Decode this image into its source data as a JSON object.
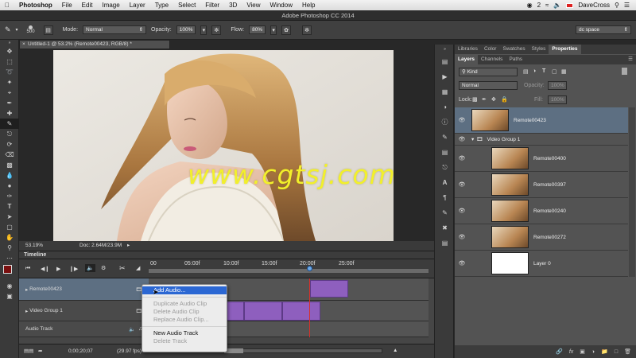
{
  "menubar": {
    "app": "Photoshop",
    "items": [
      "File",
      "Edit",
      "Image",
      "Layer",
      "Type",
      "Select",
      "Filter",
      "3D",
      "View",
      "Window",
      "Help"
    ],
    "badge": "2",
    "user": "DaveCross"
  },
  "title": "Adobe Photoshop CC 2014",
  "options": {
    "brush_size": "500",
    "mode_label": "Mode:",
    "mode_value": "Normal",
    "opacity_label": "Opacity:",
    "opacity_value": "100%",
    "flow_label": "Flow:",
    "flow_value": "80%",
    "workspace": "dc space"
  },
  "document": {
    "tab": "Untitled-1 @ 53.2% (Remote00423, RGB/8) *",
    "zoom": "53.19%",
    "doc_size": "Doc: 2.64M/23.9M",
    "watermark": "www.cgtsj.com"
  },
  "timeline": {
    "title": "Timeline",
    "ticks": [
      "00",
      "05:00f",
      "10:00f",
      "15:00f",
      "20:00f",
      "25:00f"
    ],
    "tracks": [
      {
        "name": "Remote00423"
      },
      {
        "name": "Video Group 1"
      },
      {
        "name": "Audio Track"
      }
    ],
    "timecode": "0;00;20;07",
    "fps": "(29.97 fps)"
  },
  "context_menu": {
    "items": [
      {
        "label": "Add Audio...",
        "state": "highlighted"
      },
      {
        "label": "Duplicate Audio Clip",
        "state": "disabled"
      },
      {
        "label": "Delete Audio Clip",
        "state": "disabled"
      },
      {
        "label": "Replace Audio Clip...",
        "state": "disabled"
      },
      {
        "label": "New Audio Track",
        "state": "enabled"
      },
      {
        "label": "Delete Track",
        "state": "disabled"
      }
    ]
  },
  "panels": {
    "top_tabs": [
      "Libraries",
      "Color",
      "Swatches",
      "Styles",
      "Properties"
    ],
    "layer_tabs": [
      "Layers",
      "Channels",
      "Paths"
    ],
    "kind_filter": "Kind",
    "blend_mode": "Normal",
    "opacity_label": "Opacity:",
    "opacity_value": "100%",
    "lock_label": "Lock:",
    "fill_label": "Fill:",
    "fill_value": "100%",
    "layers": [
      {
        "name": "Remote00423",
        "selected": true
      },
      {
        "name": "Video Group 1",
        "group": true
      },
      {
        "name": "Remote00400"
      },
      {
        "name": "Remote00397"
      },
      {
        "name": "Remote00240"
      },
      {
        "name": "Remote00272"
      },
      {
        "name": "Layer 0"
      }
    ]
  },
  "colors": {
    "highlight": "#2b67d3",
    "clip": "#8e5fbe",
    "playhead": "#d9302a",
    "watermark": "#f2f02b"
  }
}
